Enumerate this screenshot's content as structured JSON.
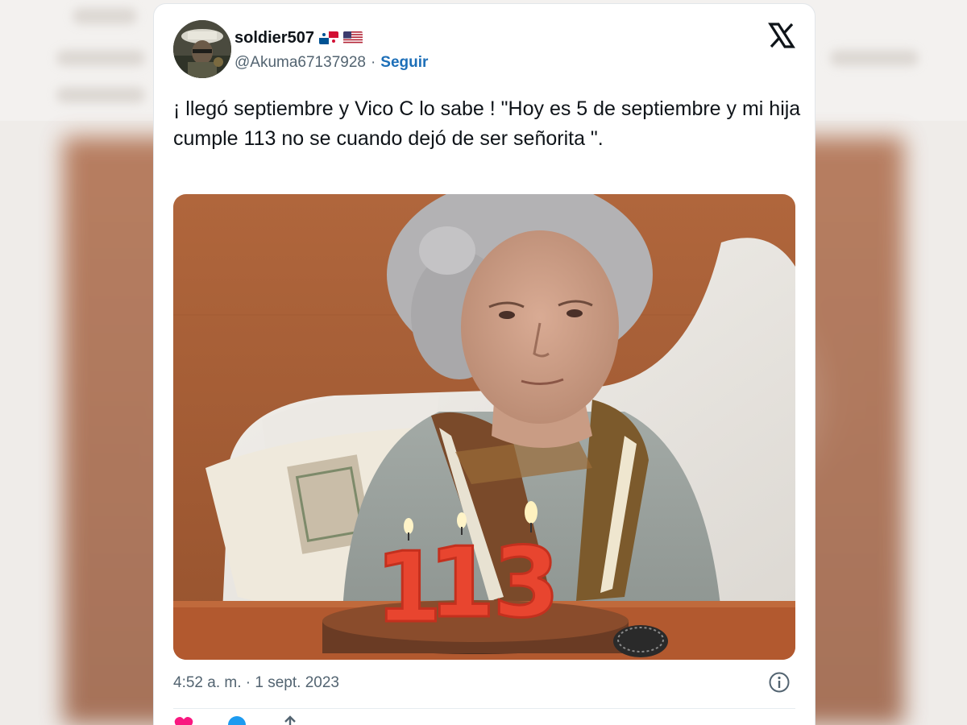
{
  "author": {
    "display_name": "soldier507",
    "flags": [
      "panama-flag",
      "usa-flag"
    ],
    "handle": "@Akuma67137928",
    "separator": "·",
    "follow_label": "Seguir"
  },
  "tweet": {
    "text": "¡ llegó septiembre y Vico C lo sabe ! \"Hoy es 5 de septiembre y mi hija cumple 113 no se cuando dejó de ser señorita \".",
    "timestamp": "4:52 a. m. · 1 sept. 2023"
  },
  "photo": {
    "candle_digits": [
      "1",
      "1",
      "3"
    ]
  },
  "icons": {
    "platform": "x-logo-icon",
    "info": "info-icon",
    "like": "heart-icon",
    "reply": "reply-icon",
    "share": "share-icon"
  },
  "colors": {
    "accent_follow": "#1d6fb8",
    "text_primary": "#0f1419",
    "text_secondary": "#536471",
    "like_red": "#f91880",
    "reply_blue": "#1d9bf0"
  }
}
